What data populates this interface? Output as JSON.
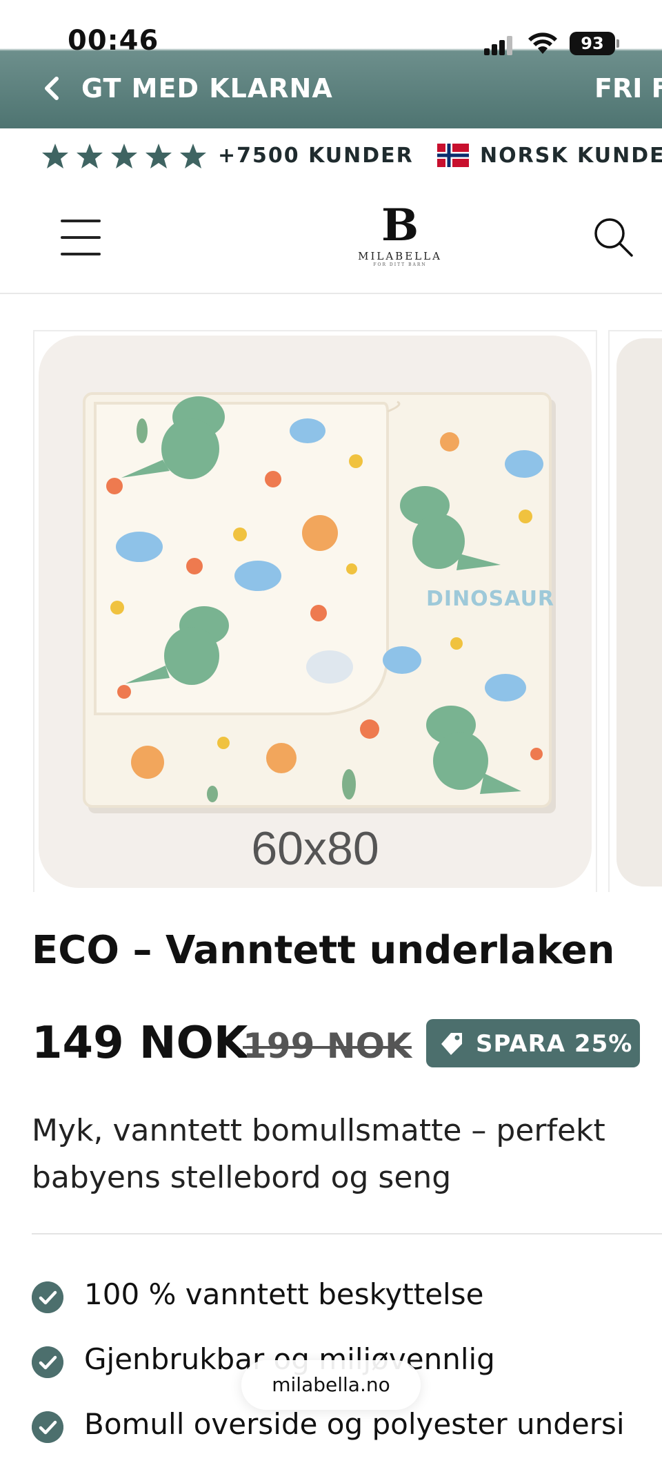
{
  "status_bar": {
    "time": "00:46",
    "battery": "93"
  },
  "announcement": {
    "primary": "GT MED KLARNA",
    "secondary": "FRI F"
  },
  "trust_bar": {
    "stars": 5,
    "customers": "+7500 KUNDER",
    "support": "NORSK KUNDES"
  },
  "header": {
    "logo_mark": "B",
    "logo_name": "MILABELLA",
    "logo_sub": "FOR DITT BARN"
  },
  "gallery": {
    "size_label": "60x80",
    "pattern_text": "DINOSAUR"
  },
  "product": {
    "title": "ECO – Vanntett underlaken",
    "price": "149 NOK",
    "compare_price": "199 NOK",
    "badge": "SPARA 25%",
    "description": "Myk, vanntett bomullsmatte – perfekt babyens stellebord og seng"
  },
  "features": [
    "100 % vanntett beskyttelse",
    "Gjenbrukbar og miljøvennlig",
    "Bomull overside og polyester undersi"
  ],
  "browser": {
    "url": "milabella.no"
  },
  "colors": {
    "brand_teal": "#4c6f6d",
    "star": "#3f6462",
    "text": "#111111"
  }
}
